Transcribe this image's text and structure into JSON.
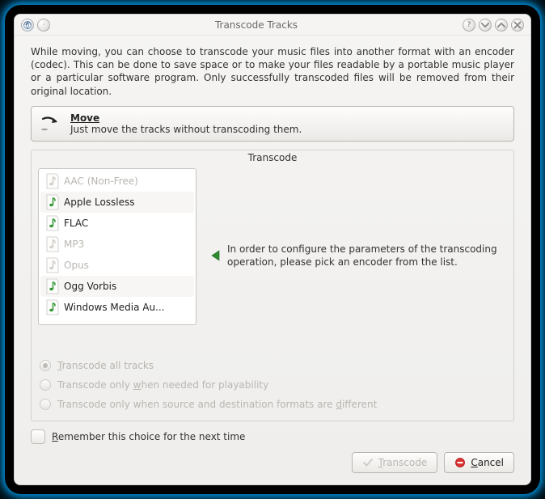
{
  "title": "Transcode Tracks",
  "description": "While moving, you can choose to transcode your music files into another format with an encoder (codec). This can be done to save space or to make your files readable by a portable music player or a particular software program. Only successfully transcoded files will be removed from their original location.",
  "move_button": {
    "title": "Move",
    "subtitle": "Just move the tracks without transcoding them."
  },
  "group_legend": "Transcode",
  "codecs": [
    {
      "label": "AAC (Non-Free)",
      "enabled": false
    },
    {
      "label": "Apple Lossless",
      "enabled": true
    },
    {
      "label": "FLAC",
      "enabled": true
    },
    {
      "label": "MP3",
      "enabled": false
    },
    {
      "label": "Opus",
      "enabled": false
    },
    {
      "label": "Ogg Vorbis",
      "enabled": true
    },
    {
      "label": "Windows Media Au...",
      "enabled": true
    }
  ],
  "hint": "In order to configure the parameters of the transcoding operation, please pick an encoder from the list.",
  "radios": [
    {
      "label_pre": "",
      "u": "T",
      "label_post": "ranscode all tracks",
      "checked": true
    },
    {
      "label_pre": "Transcode only ",
      "u": "w",
      "label_post": "hen needed for playability",
      "checked": false
    },
    {
      "label_pre": "Transcode only when source and destination formats are ",
      "u": "d",
      "label_post": "ifferent",
      "checked": false
    }
  ],
  "remember": {
    "pre": "",
    "u": "R",
    "post": "emember this choice for the next time",
    "checked": false
  },
  "buttons": {
    "transcode": {
      "pre": "",
      "u": "T",
      "post": "ranscode"
    },
    "cancel": {
      "pre": "",
      "u": "C",
      "post": "ancel"
    }
  }
}
